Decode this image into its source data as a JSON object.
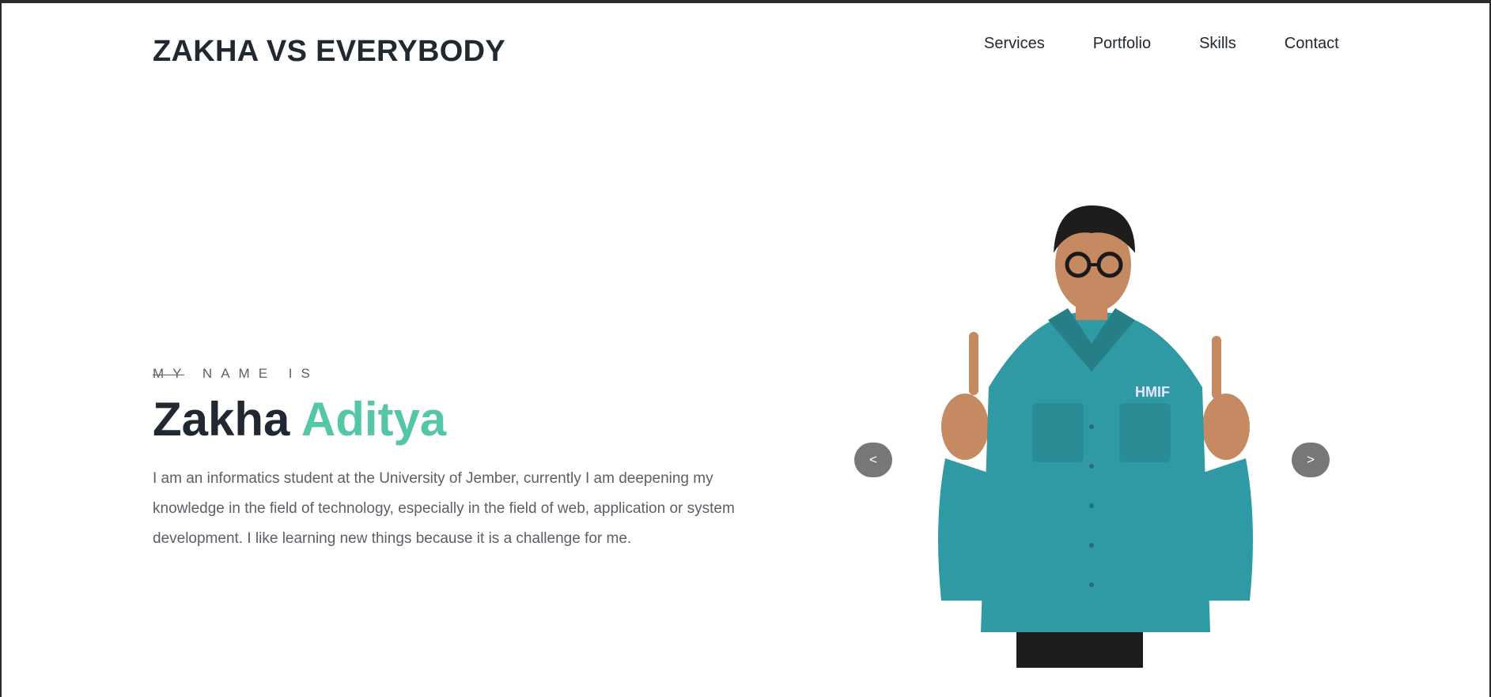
{
  "header": {
    "brand": "ZAKHA VS EVERYBODY",
    "nav": [
      "Services",
      "Portfolio",
      "Skills",
      "Contact"
    ]
  },
  "hero": {
    "eyebrow": "MY NAME IS",
    "first_name": "Zakha",
    "last_name": "Aditya",
    "bio": "I am an informatics student at the University of Jember, currently I am deepening my knowledge in the field of technology, especially in the field of web, application or system development. I like learning new things because it is a challenge for me.",
    "accent_color": "#56c6a9"
  },
  "slider": {
    "prev_label": "<",
    "next_label": ">",
    "photo": {
      "subject": "person-photo",
      "shirt_patch": "HMIF",
      "shirt_color": "#2f9aa3"
    }
  }
}
